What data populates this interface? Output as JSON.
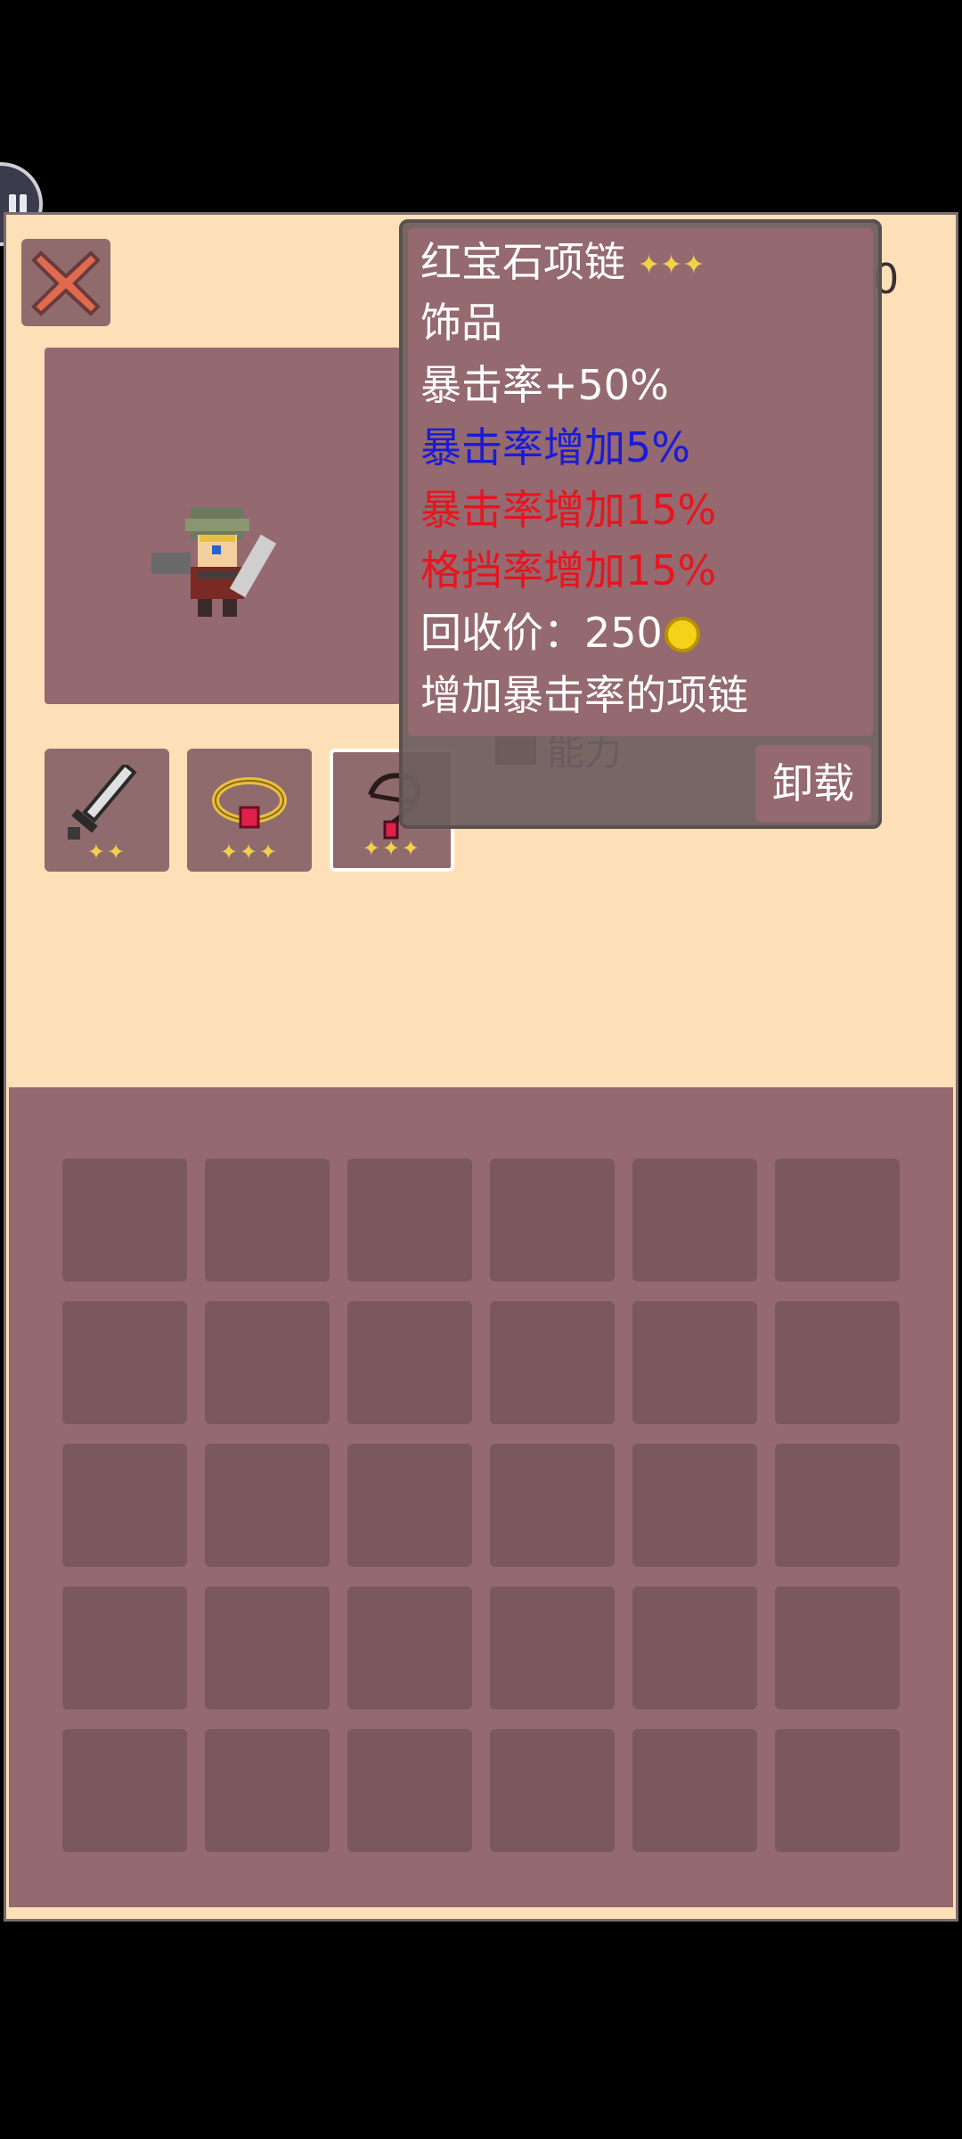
{
  "tooltip": {
    "name": "红宝石项链",
    "stars": "✦✦✦",
    "type": "饰品",
    "base_stat": "暴击率+50%",
    "affix_blue": "暴击率增加5%",
    "affix_red_1": "暴击率增加15%",
    "affix_red_2": "格挡率增加15%",
    "recycle_price": "回收价：250",
    "description": "增加暴击率的项链"
  },
  "unequip_label": "卸载",
  "ability_label": "能力",
  "hidden_partial": "0",
  "equipment": [
    {
      "item": "sword-icon",
      "stars": "✦✦"
    },
    {
      "item": "ring-icon",
      "stars": "✦✦✦"
    },
    {
      "item": "necklace-icon",
      "stars": "✦✦✦"
    }
  ],
  "colors": {
    "panel_bg": "#fee0b8",
    "slot_bg": "#8f6b6e",
    "blue_affix": "#1b1bd6",
    "red_affix": "#e8141e",
    "star": "#f3d04a"
  }
}
